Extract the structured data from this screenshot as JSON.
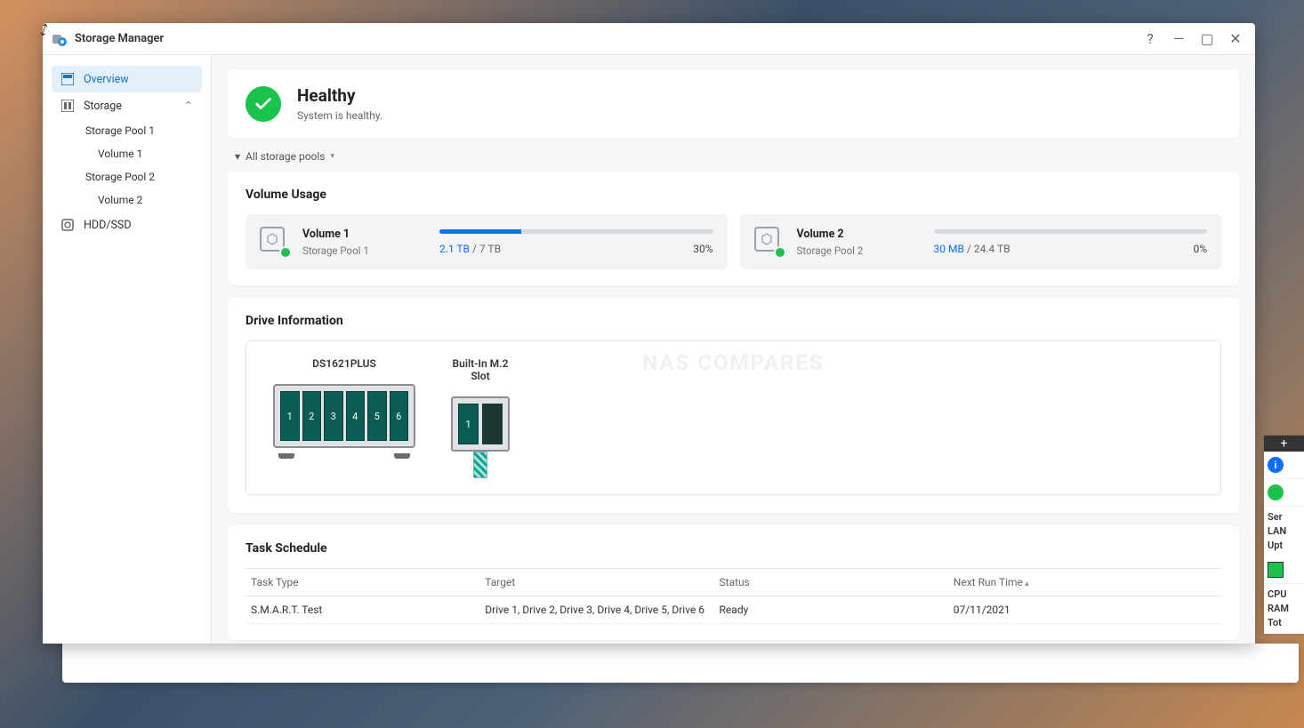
{
  "window": {
    "title": "Storage Manager"
  },
  "sidebar": {
    "overview": "Overview",
    "storage": "Storage",
    "pool1": "Storage Pool 1",
    "vol1": "Volume 1",
    "pool2": "Storage Pool 2",
    "vol2": "Volume 2",
    "hddssd": "HDD/SSD"
  },
  "health": {
    "title": "Healthy",
    "subtitle": "System is healthy."
  },
  "filter": {
    "label": "All storage pools"
  },
  "volume_usage": {
    "title": "Volume Usage",
    "volumes": [
      {
        "name": "Volume 1",
        "pool": "Storage Pool 1",
        "used": "2.1 TB",
        "sep": " / ",
        "total": "7 TB",
        "pct": "30%",
        "pct_num": 30
      },
      {
        "name": "Volume 2",
        "pool": "Storage Pool 2",
        "used": "30 MB",
        "sep": " / ",
        "total": "24.4 TB",
        "pct": "0%",
        "pct_num": 0
      }
    ]
  },
  "drive_info": {
    "title": "Drive Information",
    "device": "DS1621PLUS",
    "m2": "Built-In M.2 Slot",
    "bays": [
      "1",
      "2",
      "3",
      "4",
      "5",
      "6"
    ],
    "m2_bays": [
      "1"
    ],
    "watermark": "NAS COMPARES"
  },
  "task": {
    "title": "Task Schedule",
    "headers": {
      "type": "Task Type",
      "target": "Target",
      "status": "Status",
      "next": "Next Run Time"
    },
    "rows": [
      {
        "type": "S.M.A.R.T. Test",
        "target": "Drive 1, Drive 2, Drive 3, Drive 4, Drive 5, Drive 6",
        "status": "Ready",
        "next": "07/11/2021"
      }
    ]
  },
  "right": {
    "ser": "Ser",
    "lan": "LAN",
    "upt": "Upt",
    "cpu": "CPU",
    "ram": "RAM",
    "tot": "Tot"
  }
}
